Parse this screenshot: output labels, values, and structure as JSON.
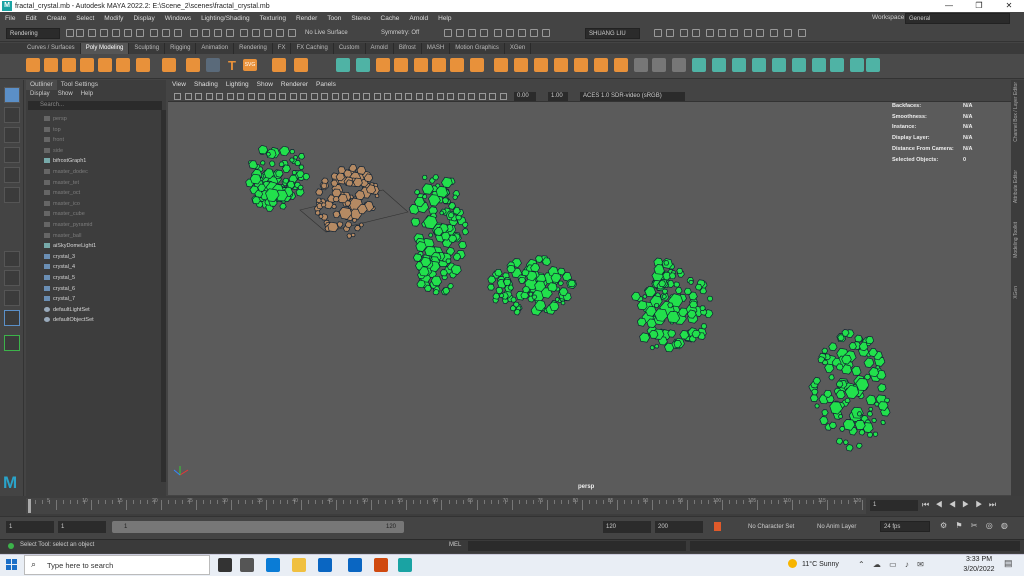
{
  "window": {
    "title": "fractal_crystal.mb - Autodesk MAYA 2022.2: E:\\Scene_2\\scenes\\fractal_crystal.mb",
    "logo": "M"
  },
  "menubar": {
    "items": [
      "File",
      "Edit",
      "Create",
      "Select",
      "Modify",
      "Display",
      "Windows",
      "Lighting/Shading",
      "Texturing",
      "Render",
      "Toon",
      "Stereo",
      "Cache",
      "Arnold",
      "Help"
    ],
    "workspace_label": "Workspace:",
    "workspace_value": "General"
  },
  "statusline": {
    "menuset": "Rendering",
    "live_surface": "No Live Surface",
    "symmetry": "Symmetry: Off",
    "user": "SHUANG LIU"
  },
  "shelf": {
    "tabs": [
      "Curves / Surfaces",
      "Poly Modeling",
      "Sculpting",
      "Rigging",
      "Animation",
      "Rendering",
      "FX",
      "FX Caching",
      "Custom",
      "Arnold",
      "Bifrost",
      "MASH",
      "Motion Graphics",
      "XGen"
    ],
    "active_tab": "Poly Modeling",
    "svg_label": "SVG",
    "text_tool": "T"
  },
  "outliner": {
    "tabs": [
      "Outliner",
      "Tool Settings"
    ],
    "menu": [
      "Display",
      "Show",
      "Help"
    ],
    "search_placeholder": "Search...",
    "items": [
      {
        "label": "persp",
        "dim": true
      },
      {
        "label": "top",
        "dim": true
      },
      {
        "label": "front",
        "dim": true
      },
      {
        "label": "side",
        "dim": true
      },
      {
        "label": "bifrostGraph1",
        "dim": false
      },
      {
        "label": "master_dodec",
        "dim": true
      },
      {
        "label": "master_tet",
        "dim": true
      },
      {
        "label": "master_oct",
        "dim": true
      },
      {
        "label": "master_ico",
        "dim": true
      },
      {
        "label": "master_cube",
        "dim": true
      },
      {
        "label": "master_pyramid",
        "dim": true
      },
      {
        "label": "master_ball",
        "dim": true
      },
      {
        "label": "aiSkyDomeLight1",
        "dim": false
      },
      {
        "label": "crystal_3",
        "dim": false
      },
      {
        "label": "crystal_4",
        "dim": false
      },
      {
        "label": "crystal_5",
        "dim": false
      },
      {
        "label": "crystal_6",
        "dim": false
      },
      {
        "label": "crystal_7",
        "dim": false
      },
      {
        "label": "defaultLightSet",
        "dim": false
      },
      {
        "label": "defaultObjectSet",
        "dim": false
      }
    ]
  },
  "viewport": {
    "menu": [
      "View",
      "Shading",
      "Lighting",
      "Show",
      "Renderer",
      "Panels"
    ],
    "exposure": "0.00",
    "gamma": "1.00",
    "colorspace": "ACES 1.0 SDR-video (sRGB)",
    "camera_label": "persp",
    "hud": [
      {
        "label": "Backfaces:",
        "value": "N/A"
      },
      {
        "label": "Smoothness:",
        "value": "N/A"
      },
      {
        "label": "Instance:",
        "value": "N/A"
      },
      {
        "label": "Display Layer:",
        "value": "N/A"
      },
      {
        "label": "Distance From Camera:",
        "value": "N/A"
      },
      {
        "label": "Selected Objects:",
        "value": "0"
      }
    ],
    "crystal_color": "#22e04c",
    "selected_color": "#b58a63"
  },
  "right_tabs": [
    "Channel Box / Layer Editor",
    "Attribute Editor",
    "Modeling Toolkit",
    "XGen"
  ],
  "timeline": {
    "ticks": [
      "5",
      "10",
      "15",
      "20",
      "25",
      "30",
      "35",
      "40",
      "45",
      "50",
      "55",
      "60",
      "65",
      "70",
      "75",
      "80",
      "85",
      "90",
      "95",
      "100",
      "105",
      "110",
      "115",
      "120"
    ],
    "current_frame": "1"
  },
  "range": {
    "start": "1",
    "playback_start": "1",
    "slider_start": "1",
    "slider_end": "120",
    "playback_end": "120",
    "end": "200",
    "character_set": "No Character Set",
    "anim_layer": "No Anim Layer",
    "fps": "24 fps"
  },
  "cmdline": {
    "help": "Select Tool: select an object",
    "mel": "MEL"
  },
  "taskbar": {
    "search_placeholder": "Type here to search",
    "weather": "11°C  Sunny",
    "time": "3:33 PM",
    "date": "3/20/2022"
  }
}
